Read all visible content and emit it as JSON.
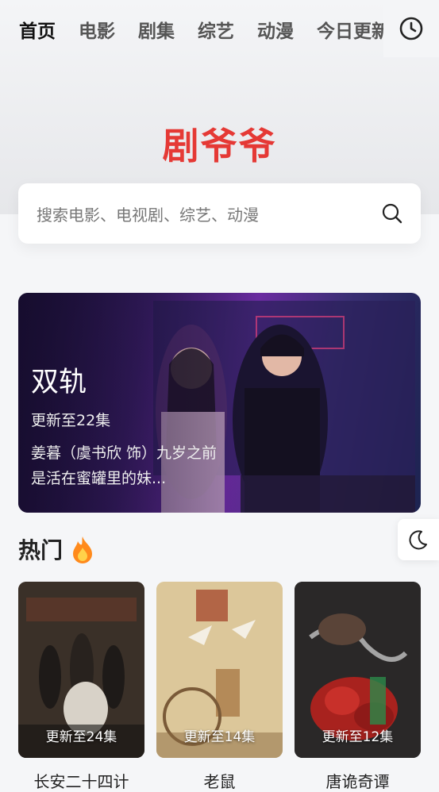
{
  "nav": {
    "tabs": [
      "首页",
      "电影",
      "剧集",
      "综艺",
      "动漫",
      "今日更新"
    ],
    "active_index": 0,
    "accent": "#ffd76a"
  },
  "brand": {
    "logo": "剧爷爷",
    "color": "#e53935"
  },
  "search": {
    "placeholder": "搜索电影、电视剧、综艺、动漫"
  },
  "banner": {
    "title": "双轨",
    "update": "更新至22集",
    "desc": "姜暮（虞书欣 饰）九岁之前是活在蜜罐里的妹..."
  },
  "section": {
    "title": "热门"
  },
  "posters": [
    {
      "badge": "更新至24集",
      "name": "长安二十四计"
    },
    {
      "badge": "更新至14集",
      "name": "老鼠"
    },
    {
      "badge": "更新至12集",
      "name": "唐诡奇谭"
    }
  ]
}
